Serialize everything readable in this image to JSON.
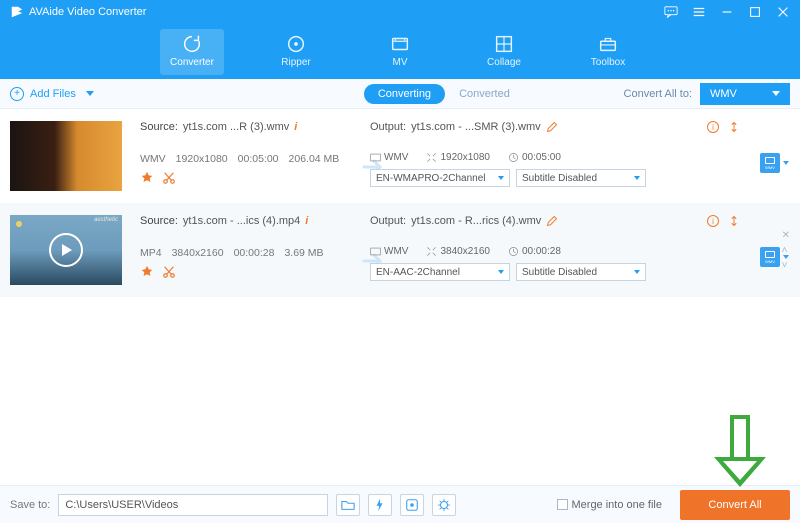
{
  "app": {
    "title": "AVAide Video Converter"
  },
  "nav": {
    "converter": "Converter",
    "ripper": "Ripper",
    "mv": "MV",
    "collage": "Collage",
    "toolbox": "Toolbox"
  },
  "subbar": {
    "addFiles": "Add Files",
    "tabConverting": "Converting",
    "tabConverted": "Converted",
    "convertAllTo": "Convert All to:",
    "targetFormat": "WMV"
  },
  "items": [
    {
      "sourcePrefix": "Source:",
      "sourceName": "yt1s.com ...R (3).wmv",
      "format": "WMV",
      "resolution": "1920x1080",
      "duration": "00:05:00",
      "size": "206.04 MB",
      "outputPrefix": "Output:",
      "outputName": "yt1s.com - ...SMR (3).wmv",
      "outFormat": "WMV",
      "outResolution": "1920x1080",
      "outDuration": "00:05:00",
      "encoder": "EN-WMAPRO-2Channel",
      "subtitle": "Subtitle Disabled",
      "formatBadge": "WMV"
    },
    {
      "sourcePrefix": "Source:",
      "sourceName": "yt1s.com - ...ics (4).mp4",
      "format": "MP4",
      "resolution": "3840x2160",
      "duration": "00:00:28",
      "size": "3.69 MB",
      "outputPrefix": "Output:",
      "outputName": "yt1s.com - R...rics (4).wmv",
      "outFormat": "WMV",
      "outResolution": "3840x2160",
      "outDuration": "00:00:28",
      "encoder": "EN-AAC-2Channel",
      "subtitle": "Subtitle Disabled",
      "formatBadge": "WMV"
    }
  ],
  "bottom": {
    "saveTo": "Save to:",
    "path": "C:\\Users\\USER\\Videos",
    "merge": "Merge into one file",
    "convertAll": "Convert All"
  }
}
